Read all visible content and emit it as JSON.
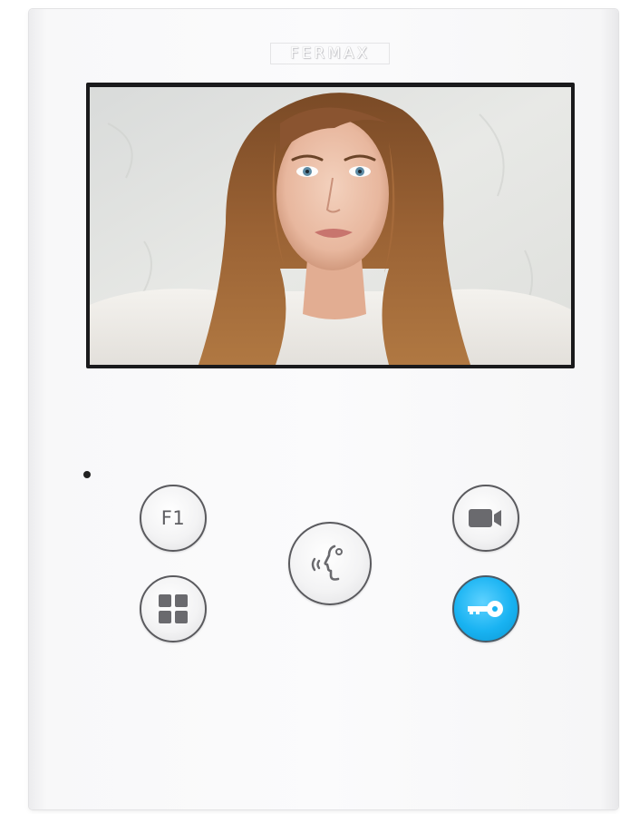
{
  "device": {
    "brand": "FERMAX"
  },
  "screen": {
    "content": "woman-portrait"
  },
  "buttons": {
    "f1": {
      "label": "F1",
      "icon": "f1-text"
    },
    "menu": {
      "icon": "grid-icon"
    },
    "talk": {
      "icon": "speech-icon"
    },
    "camera": {
      "icon": "camera-icon"
    },
    "door_open": {
      "icon": "key-icon",
      "color": "#19b3f2"
    }
  },
  "colors": {
    "panel": "#fbfbfc",
    "accent": "#19b3f2",
    "icon_gray": "#6a6a6e"
  }
}
